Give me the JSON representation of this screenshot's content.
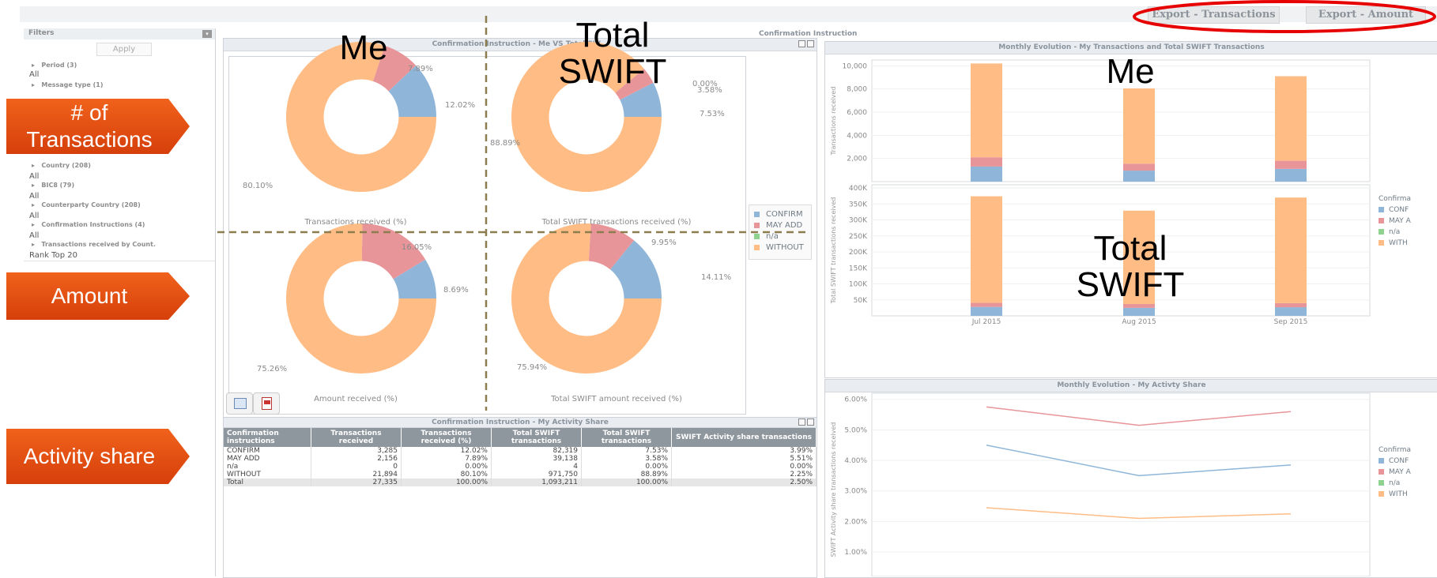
{
  "colors": {
    "confirm": "#8fb6d9",
    "may_add": "#e8959a",
    "na": "#8fd18f",
    "without": "#ffbc84",
    "callout": "#e24c10",
    "highlight": "#e60000"
  },
  "export": {
    "transactions": "Export - Transactions",
    "amount": "Export - Amount"
  },
  "filters": {
    "title": "Filters",
    "apply": "Apply",
    "items": [
      {
        "label": "Period (3)",
        "all": "All"
      },
      {
        "label": "Message type (1)",
        "all": ""
      },
      {
        "label": "Country (208)",
        "all": "All"
      },
      {
        "label": "BIC8 (79)",
        "all": "All"
      },
      {
        "label": "Counterparty Country (208)",
        "all": "All"
      },
      {
        "label": "Confirmation Instructions (4)",
        "all": "All"
      },
      {
        "label": "Transactions received by Count.",
        "all": "Rank Top 20"
      }
    ]
  },
  "section_title": "Confirmation Instruction",
  "callouts": {
    "transactions": "# of Transactions",
    "amount": "Amount",
    "activity": "Activity share"
  },
  "overlay": {
    "me_left": "Me",
    "total_left": "Total SWIFT",
    "me_right": "Me",
    "total_right": "Total SWIFT"
  },
  "donut_panel": {
    "title": "Confirmation Instruction - Me VS Total SW...",
    "legend": [
      {
        "name": "CONFIRM",
        "color": "#8fb6d9"
      },
      {
        "name": "MAY ADD",
        "color": "#e8959a"
      },
      {
        "name": "n/a",
        "color": "#8fd18f"
      },
      {
        "name": "WITHOUT",
        "color": "#ffbc84"
      }
    ],
    "donuts": [
      {
        "caption": "Transactions received (%)",
        "labels": [
          "12.02%",
          "7.89%",
          "80.10%"
        ]
      },
      {
        "caption": "Total SWIFT transactions received (%)",
        "labels": [
          "7.53%",
          "3.58%",
          "0.00%",
          "88.89%"
        ]
      },
      {
        "caption": "Amount received (%)",
        "labels": [
          "8.69%",
          "16.05%",
          "75.26%"
        ]
      },
      {
        "caption": "Total SWIFT amount received (%)",
        "labels": [
          "14.11%",
          "9.95%",
          "75.94%"
        ]
      }
    ]
  },
  "chart_data": [
    {
      "type": "pie",
      "title": "Transactions received (%)",
      "categories": [
        "CONFIRM",
        "MAY ADD",
        "n/a",
        "WITHOUT"
      ],
      "values": [
        12.02,
        7.89,
        0,
        80.1
      ]
    },
    {
      "type": "pie",
      "title": "Total SWIFT transactions received (%)",
      "categories": [
        "CONFIRM",
        "MAY ADD",
        "n/a",
        "WITHOUT"
      ],
      "values": [
        7.53,
        3.58,
        0.0,
        88.89
      ]
    },
    {
      "type": "pie",
      "title": "Amount received (%)",
      "categories": [
        "CONFIRM",
        "MAY ADD",
        "n/a",
        "WITHOUT"
      ],
      "values": [
        8.69,
        16.05,
        0,
        75.26
      ]
    },
    {
      "type": "pie",
      "title": "Total SWIFT amount received (%)",
      "categories": [
        "CONFIRM",
        "MAY ADD",
        "n/a",
        "WITHOUT"
      ],
      "values": [
        14.11,
        9.95,
        0,
        75.94
      ]
    },
    {
      "type": "bar",
      "title": "Monthly Evolution - My Transactions and Total SWIFT Transactions",
      "ylabel": "Transactions received",
      "ylim": [
        0,
        10500
      ],
      "yticks": [
        "10,000",
        "8,000",
        "6,000",
        "4,000",
        "2,000"
      ],
      "categories": [
        "Jul 2015",
        "Aug 2015",
        "Sep 2015"
      ],
      "series": [
        {
          "name": "CONFIRM",
          "values": [
            1300,
            950,
            1100
          ]
        },
        {
          "name": "MAY ADD",
          "values": [
            800,
            600,
            700
          ]
        },
        {
          "name": "WITHOUT",
          "values": [
            8100,
            6500,
            7300
          ]
        }
      ]
    },
    {
      "type": "bar",
      "ylabel": "Total SWIFT transactions received",
      "ylim": [
        0,
        410000
      ],
      "yticks": [
        "400K",
        "350K",
        "300K",
        "250K",
        "200K",
        "150K",
        "100K",
        "50K"
      ],
      "categories": [
        "Jul 2015",
        "Aug 2015",
        "Sep 2015"
      ],
      "series": [
        {
          "name": "CONFIRM",
          "values": [
            28000,
            25000,
            27000
          ]
        },
        {
          "name": "MAY ADD",
          "values": [
            13000,
            12000,
            13000
          ]
        },
        {
          "name": "WITHOUT",
          "values": [
            333000,
            292000,
            330000
          ]
        }
      ]
    },
    {
      "type": "line",
      "title": "Monthly Evolution - My Activty Share",
      "ylabel": "SWIFT Activity share transactions received",
      "ylim": [
        0.5,
        6.0
      ],
      "yticks": [
        "6.00%",
        "5.00%",
        "4.00%",
        "3.00%",
        "2.00%",
        "1.00%"
      ],
      "categories": [
        "Jul 2015",
        "Aug 2015",
        "Sep 2015"
      ],
      "series": [
        {
          "name": "CONFIRM",
          "values": [
            4.5,
            3.5,
            3.85
          ]
        },
        {
          "name": "MAY ADD",
          "values": [
            5.75,
            5.15,
            5.6
          ]
        },
        {
          "name": "WITHOUT",
          "values": [
            2.45,
            2.1,
            2.25
          ]
        }
      ]
    }
  ],
  "bar_panel": {
    "title": "Monthly Evolution - My Transactions and Total SWIFT Transactions",
    "legend_title": "Confirma",
    "legend": [
      "CONF",
      "MAY A",
      "n/a",
      "WITH"
    ]
  },
  "line_panel": {
    "title": "Monthly Evolution - My Activty Share",
    "legend_title": "Confirma",
    "legend": [
      "CONF",
      "MAY A",
      "n/a",
      "WITH"
    ]
  },
  "table": {
    "title": "Confirmation Instruction - My Activity Share",
    "headers": [
      "Confirmation instructions",
      "Transactions received",
      "Transactions received (%)",
      "Total SWIFT transactions",
      "Total SWIFT transactions",
      "SWIFT Activity share transactions"
    ],
    "rows": [
      [
        "CONFIRM",
        "3,285",
        "12.02%",
        "82,319",
        "7.53%",
        "3.99%"
      ],
      [
        "MAY ADD",
        "2,156",
        "7.89%",
        "39,138",
        "3.58%",
        "5.51%"
      ],
      [
        "n/a",
        "0",
        "0.00%",
        "4",
        "0.00%",
        "0.00%"
      ],
      [
        "WITHOUT",
        "21,894",
        "80.10%",
        "971,750",
        "88.89%",
        "2.25%"
      ],
      [
        "Total",
        "27,335",
        "100.00%",
        "1,093,211",
        "100.00%",
        "2.50%"
      ]
    ]
  }
}
